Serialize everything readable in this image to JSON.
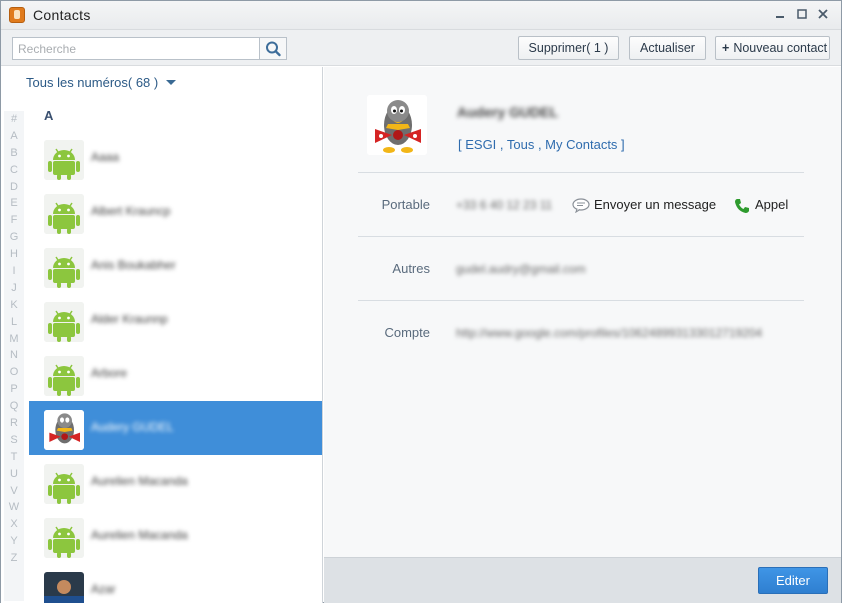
{
  "window": {
    "title": "Contacts"
  },
  "toolbar": {
    "search_placeholder": "Recherche",
    "delete_label": "Supprimer( 1 )",
    "refresh_label": "Actualiser",
    "new_contact_label": "Nouveau contact"
  },
  "list": {
    "filter_label": "Tous les numéros( 68 )",
    "alphabet": [
      "#",
      "A",
      "B",
      "C",
      "D",
      "E",
      "F",
      "G",
      "H",
      "I",
      "J",
      "K",
      "L",
      "M",
      "N",
      "O",
      "P",
      "Q",
      "R",
      "S",
      "T",
      "U",
      "V",
      "W",
      "X",
      "Y",
      "Z"
    ],
    "section": "A",
    "contacts": [
      {
        "name": "Aaaa",
        "avatar": "android-avatar",
        "selected": false
      },
      {
        "name": "Albert Krauncp",
        "avatar": "android-avatar",
        "selected": false
      },
      {
        "name": "Anis Boukabher",
        "avatar": "android-avatar",
        "selected": false
      },
      {
        "name": "Alder Kraunnp",
        "avatar": "android-avatar",
        "selected": false
      },
      {
        "name": "Arbore",
        "avatar": "android-avatar",
        "selected": false
      },
      {
        "name": "Audery GUDEL",
        "avatar": "tux-avatar",
        "selected": true
      },
      {
        "name": "Aurelien Macanda",
        "avatar": "android-avatar",
        "selected": false
      },
      {
        "name": "Aurelien Macanda",
        "avatar": "android-avatar",
        "selected": false
      },
      {
        "name": "Azar",
        "avatar": "photo-avatar",
        "selected": false
      }
    ]
  },
  "detail": {
    "name": "Audery GUDEL",
    "groups": "[ ESGI , Tous , My Contacts ]",
    "fields": [
      {
        "label": "Portable",
        "value": "+33 6 40 12 23 11"
      },
      {
        "label": "Autres",
        "value": "gudel.audry@gmail.com"
      },
      {
        "label": "Compte",
        "value": "http://www.google.com/profiles/106248993133012719204"
      }
    ],
    "send_message_label": "Envoyer un message",
    "call_label": "Appel",
    "edit_label": "Editer"
  },
  "colors": {
    "selection": "#3f8ed9",
    "link": "#2f6cae",
    "primary_button": "#2f7fd0"
  }
}
